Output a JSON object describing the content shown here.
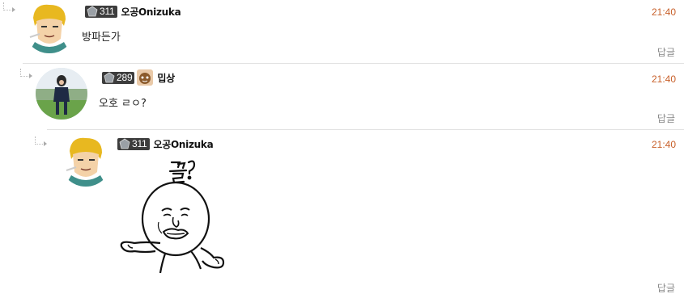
{
  "comments": [
    {
      "level": "311",
      "nickname": "오공Onizuka",
      "time": "21:40",
      "text": "방파든가",
      "reply_label": "답글"
    },
    {
      "level": "289",
      "nickname": "밉상",
      "time": "21:40",
      "text": "오호 ㄹㅇ?",
      "reply_label": "답글"
    },
    {
      "level": "311",
      "nickname": "오공Onizuka",
      "time": "21:40",
      "text": "",
      "reply_label": "답글"
    }
  ],
  "colors": {
    "time": "#c8602a",
    "level_bg": "#3d3d3d",
    "reply": "#888888",
    "divider": "#e2e2e2"
  },
  "icons": [
    "reply-arrow-icon",
    "level-gem-icon",
    "user-badge-icon"
  ]
}
